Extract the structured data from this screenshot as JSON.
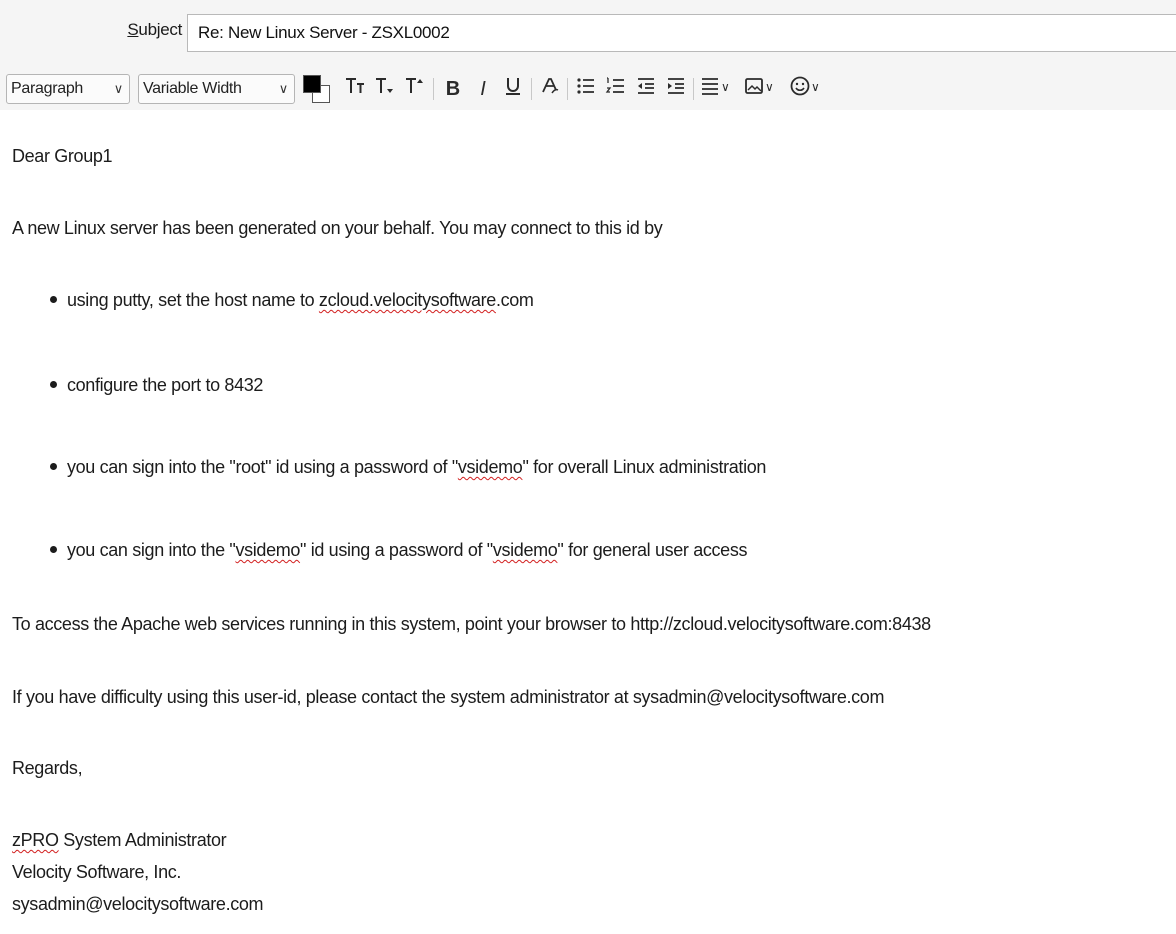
{
  "header": {
    "subject_label_accel": "S",
    "subject_label_rest": "ubject",
    "subject_value": "Re: New Linux Server - ZSXL0002"
  },
  "toolbar": {
    "paragraph_format": "Paragraph",
    "font_family": "Variable Width",
    "text_color": "#000000",
    "background_color": "#ffffff",
    "icons": [
      "font-smaller-icon",
      "font-size-icon",
      "font-larger-icon",
      "bold-icon",
      "italic-icon",
      "underline-icon",
      "remove-formatting-icon",
      "bullet-list-icon",
      "numbered-list-icon",
      "outdent-icon",
      "indent-icon",
      "align-icon",
      "insert-image-icon",
      "emoji-icon"
    ]
  },
  "body": {
    "greeting": "Dear Group1",
    "intro": "A new Linux server has been generated on your behalf. You may connect to this id by",
    "bullets": [
      {
        "pre": "using putty, set the host name to ",
        "mark1": "zcloud.velocitysoftware",
        "post": ".com"
      },
      {
        "text": "configure the port to 8432"
      },
      {
        "pre": "you can sign into the \"root\" id using a password of \"",
        "mark1": "vsidemo",
        "post": "\" for overall Linux administration"
      },
      {
        "pre": "you can sign into the \"",
        "mark1": "vsidemo",
        "mid": "\" id using a password of \"",
        "mark2": "vsidemo",
        "post": "\" for general user access"
      }
    ],
    "apache_line": "To access the Apache web services running in this system, point your browser to http://zcloud.velocitysoftware.com:8438",
    "difficulty_line": "If you have difficulty using this user-id, please contact the system administrator at sysadmin@velocitysoftware.com",
    "regards": "Regards,",
    "signature": {
      "name_mark": "zPRO",
      "name_rest": " System Administrator",
      "company": "Velocity Software, Inc.",
      "email": "sysadmin@velocitysoftware.com"
    }
  }
}
